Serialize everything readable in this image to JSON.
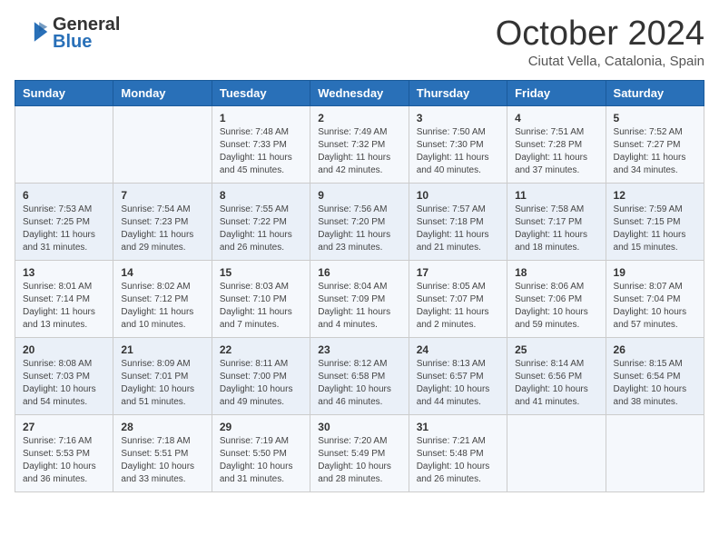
{
  "logo": {
    "line1": "General",
    "line2": "Blue"
  },
  "title": "October 2024",
  "subtitle": "Ciutat Vella, Catalonia, Spain",
  "days_of_week": [
    "Sunday",
    "Monday",
    "Tuesday",
    "Wednesday",
    "Thursday",
    "Friday",
    "Saturday"
  ],
  "weeks": [
    [
      {
        "day": "",
        "info": ""
      },
      {
        "day": "",
        "info": ""
      },
      {
        "day": "1",
        "info": "Sunrise: 7:48 AM\nSunset: 7:33 PM\nDaylight: 11 hours and 45 minutes."
      },
      {
        "day": "2",
        "info": "Sunrise: 7:49 AM\nSunset: 7:32 PM\nDaylight: 11 hours and 42 minutes."
      },
      {
        "day": "3",
        "info": "Sunrise: 7:50 AM\nSunset: 7:30 PM\nDaylight: 11 hours and 40 minutes."
      },
      {
        "day": "4",
        "info": "Sunrise: 7:51 AM\nSunset: 7:28 PM\nDaylight: 11 hours and 37 minutes."
      },
      {
        "day": "5",
        "info": "Sunrise: 7:52 AM\nSunset: 7:27 PM\nDaylight: 11 hours and 34 minutes."
      }
    ],
    [
      {
        "day": "6",
        "info": "Sunrise: 7:53 AM\nSunset: 7:25 PM\nDaylight: 11 hours and 31 minutes."
      },
      {
        "day": "7",
        "info": "Sunrise: 7:54 AM\nSunset: 7:23 PM\nDaylight: 11 hours and 29 minutes."
      },
      {
        "day": "8",
        "info": "Sunrise: 7:55 AM\nSunset: 7:22 PM\nDaylight: 11 hours and 26 minutes."
      },
      {
        "day": "9",
        "info": "Sunrise: 7:56 AM\nSunset: 7:20 PM\nDaylight: 11 hours and 23 minutes."
      },
      {
        "day": "10",
        "info": "Sunrise: 7:57 AM\nSunset: 7:18 PM\nDaylight: 11 hours and 21 minutes."
      },
      {
        "day": "11",
        "info": "Sunrise: 7:58 AM\nSunset: 7:17 PM\nDaylight: 11 hours and 18 minutes."
      },
      {
        "day": "12",
        "info": "Sunrise: 7:59 AM\nSunset: 7:15 PM\nDaylight: 11 hours and 15 minutes."
      }
    ],
    [
      {
        "day": "13",
        "info": "Sunrise: 8:01 AM\nSunset: 7:14 PM\nDaylight: 11 hours and 13 minutes."
      },
      {
        "day": "14",
        "info": "Sunrise: 8:02 AM\nSunset: 7:12 PM\nDaylight: 11 hours and 10 minutes."
      },
      {
        "day": "15",
        "info": "Sunrise: 8:03 AM\nSunset: 7:10 PM\nDaylight: 11 hours and 7 minutes."
      },
      {
        "day": "16",
        "info": "Sunrise: 8:04 AM\nSunset: 7:09 PM\nDaylight: 11 hours and 4 minutes."
      },
      {
        "day": "17",
        "info": "Sunrise: 8:05 AM\nSunset: 7:07 PM\nDaylight: 11 hours and 2 minutes."
      },
      {
        "day": "18",
        "info": "Sunrise: 8:06 AM\nSunset: 7:06 PM\nDaylight: 10 hours and 59 minutes."
      },
      {
        "day": "19",
        "info": "Sunrise: 8:07 AM\nSunset: 7:04 PM\nDaylight: 10 hours and 57 minutes."
      }
    ],
    [
      {
        "day": "20",
        "info": "Sunrise: 8:08 AM\nSunset: 7:03 PM\nDaylight: 10 hours and 54 minutes."
      },
      {
        "day": "21",
        "info": "Sunrise: 8:09 AM\nSunset: 7:01 PM\nDaylight: 10 hours and 51 minutes."
      },
      {
        "day": "22",
        "info": "Sunrise: 8:11 AM\nSunset: 7:00 PM\nDaylight: 10 hours and 49 minutes."
      },
      {
        "day": "23",
        "info": "Sunrise: 8:12 AM\nSunset: 6:58 PM\nDaylight: 10 hours and 46 minutes."
      },
      {
        "day": "24",
        "info": "Sunrise: 8:13 AM\nSunset: 6:57 PM\nDaylight: 10 hours and 44 minutes."
      },
      {
        "day": "25",
        "info": "Sunrise: 8:14 AM\nSunset: 6:56 PM\nDaylight: 10 hours and 41 minutes."
      },
      {
        "day": "26",
        "info": "Sunrise: 8:15 AM\nSunset: 6:54 PM\nDaylight: 10 hours and 38 minutes."
      }
    ],
    [
      {
        "day": "27",
        "info": "Sunrise: 7:16 AM\nSunset: 5:53 PM\nDaylight: 10 hours and 36 minutes."
      },
      {
        "day": "28",
        "info": "Sunrise: 7:18 AM\nSunset: 5:51 PM\nDaylight: 10 hours and 33 minutes."
      },
      {
        "day": "29",
        "info": "Sunrise: 7:19 AM\nSunset: 5:50 PM\nDaylight: 10 hours and 31 minutes."
      },
      {
        "day": "30",
        "info": "Sunrise: 7:20 AM\nSunset: 5:49 PM\nDaylight: 10 hours and 28 minutes."
      },
      {
        "day": "31",
        "info": "Sunrise: 7:21 AM\nSunset: 5:48 PM\nDaylight: 10 hours and 26 minutes."
      },
      {
        "day": "",
        "info": ""
      },
      {
        "day": "",
        "info": ""
      }
    ]
  ]
}
